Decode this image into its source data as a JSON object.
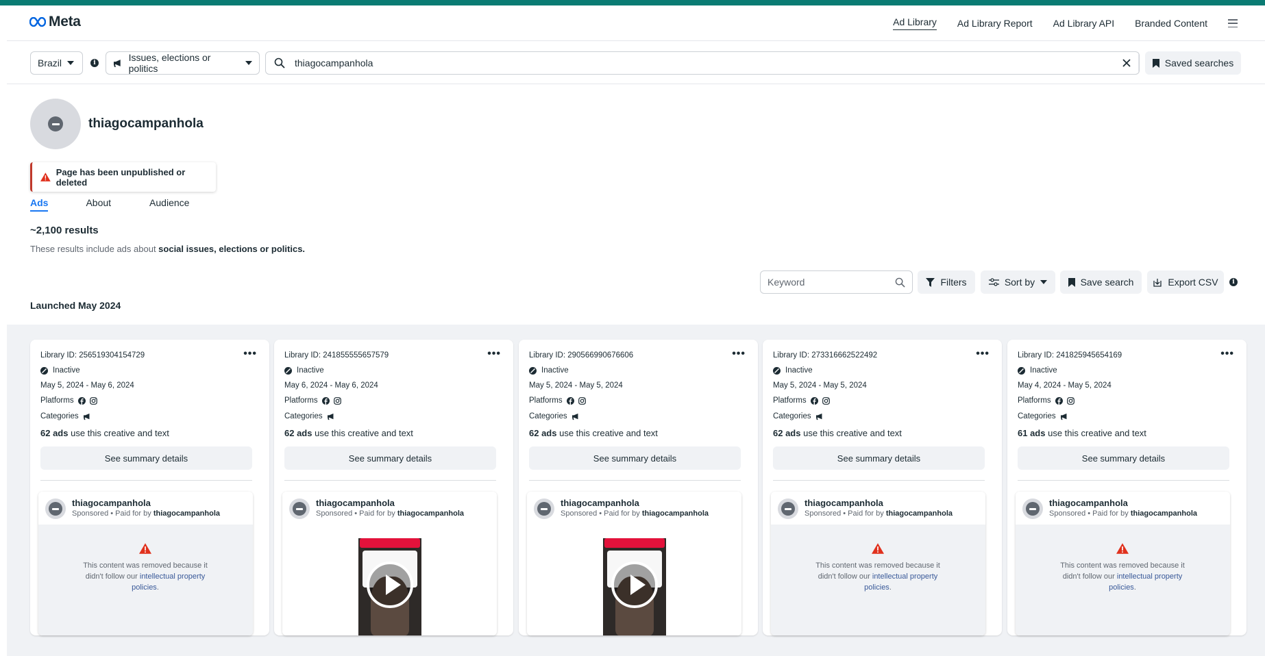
{
  "header": {
    "brand": "Meta",
    "nav": [
      "Ad Library",
      "Ad Library Report",
      "Ad Library API",
      "Branded Content"
    ],
    "active_nav": "Ad Library",
    "menu_icon": "hamburger-icon"
  },
  "search": {
    "country": "Brazil",
    "category": "Issues, elections or politics",
    "query": "thiagocampanhola",
    "saved_searches_label": "Saved searches"
  },
  "profile": {
    "name": "thiagocampanhola",
    "alert": "Page has been unpublished or deleted",
    "tabs": [
      "Ads",
      "About",
      "Audience"
    ],
    "active_tab": "Ads"
  },
  "results": {
    "count": "~2,100 results",
    "note_prefix": "These results include ads about ",
    "note_bold": "social issues, elections or politics."
  },
  "toolbar": {
    "keyword_placeholder": "Keyword",
    "filters": "Filters",
    "sort_by": "Sort by",
    "save_search": "Save search",
    "export_csv": "Export CSV"
  },
  "section_title": "Launched May 2024",
  "labels": {
    "platforms": "Platforms",
    "categories": "Categories",
    "see_summary": "See summary details",
    "use_text": "use this creative and text",
    "sponsored": "Sponsored",
    "paid_for_by": " • Paid for by ",
    "removed_msg": "This content was removed because it didn't follow our ",
    "removed_link": "intellectual property policies",
    "removed_end": "."
  },
  "colors": {
    "accent": "#1877f2",
    "topbar": "#0a7b73",
    "alert": "#c0392b",
    "warning": "#e0311d"
  },
  "cards": [
    {
      "library_id": "Library ID: 256519304154729",
      "status": "Inactive",
      "dates": "May 5, 2024 - May 6, 2024",
      "ads_count": "62 ads",
      "advertiser": "thiagocampanhola",
      "paid_by": "thiagocampanhola",
      "media": "removed"
    },
    {
      "library_id": "Library ID: 241855555657579",
      "status": "Inactive",
      "dates": "May 6, 2024 - May 6, 2024",
      "ads_count": "62 ads",
      "advertiser": "thiagocampanhola",
      "paid_by": "thiagocampanhola",
      "media": "video"
    },
    {
      "library_id": "Library ID: 290566990676606",
      "status": "Inactive",
      "dates": "May 5, 2024 - May 5, 2024",
      "ads_count": "62 ads",
      "advertiser": "thiagocampanhola",
      "paid_by": "thiagocampanhola",
      "media": "video"
    },
    {
      "library_id": "Library ID: 273316662522492",
      "status": "Inactive",
      "dates": "May 5, 2024 - May 5, 2024",
      "ads_count": "62 ads",
      "advertiser": "thiagocampanhola",
      "paid_by": "thiagocampanhola",
      "media": "removed"
    },
    {
      "library_id": "Library ID: 241825945654169",
      "status": "Inactive",
      "dates": "May 4, 2024 - May 5, 2024",
      "ads_count": "61 ads",
      "advertiser": "thiagocampanhola",
      "paid_by": "thiagocampanhola",
      "media": "removed"
    }
  ]
}
